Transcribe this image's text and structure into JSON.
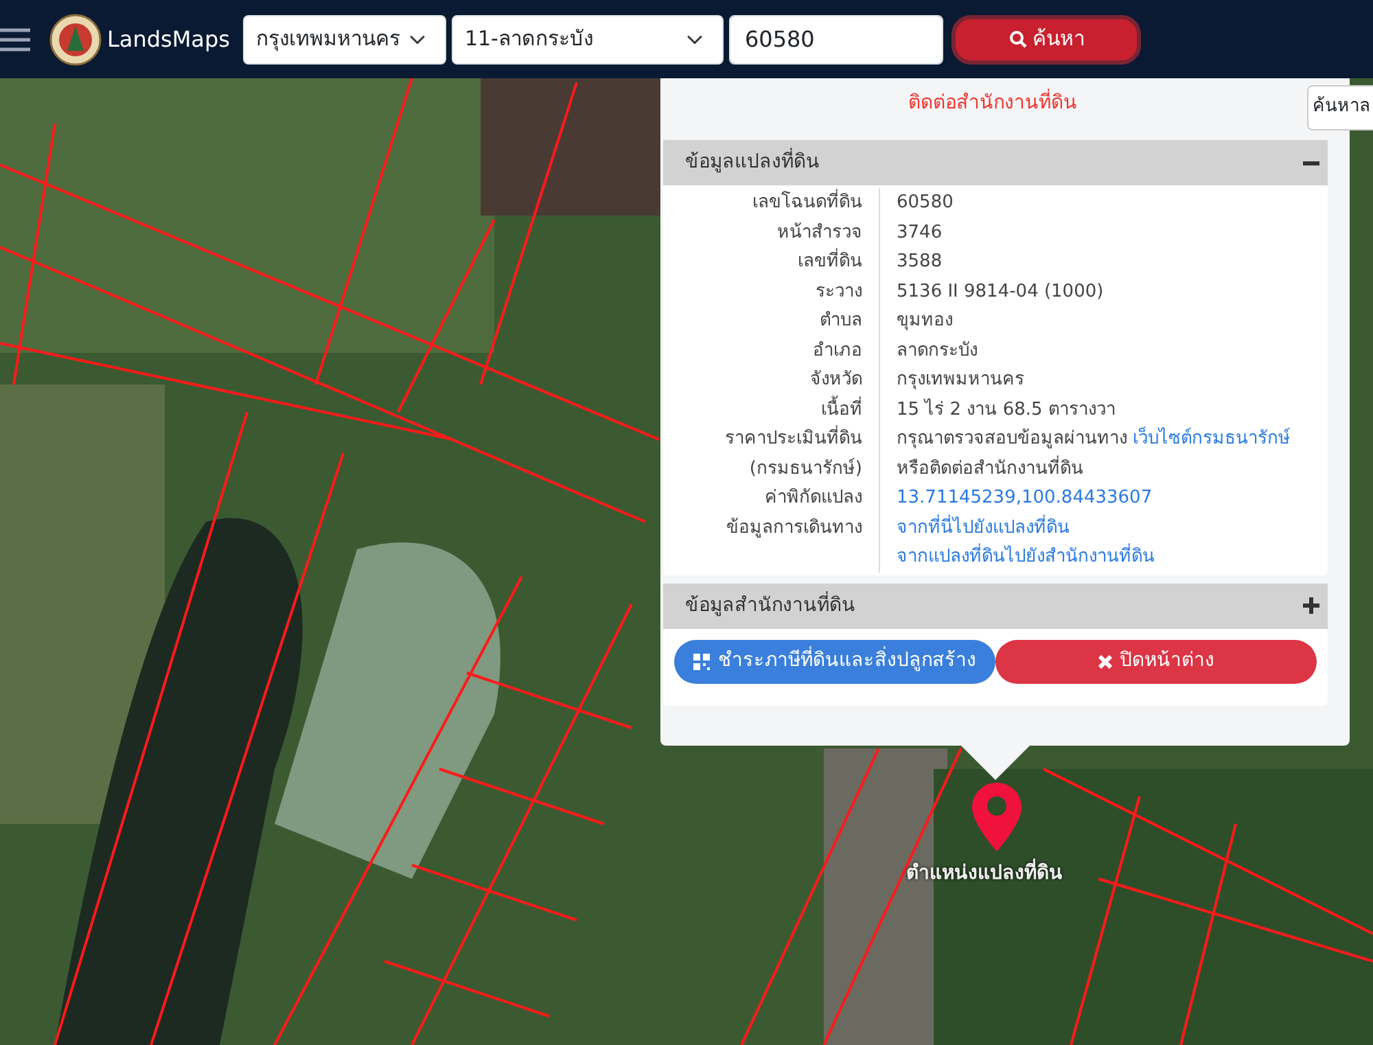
{
  "navbar": {
    "brand": "LandsMaps",
    "province": "กรุงเทพมหานคร",
    "district": "11-ลาดกระบัง",
    "parcel_no": "60580",
    "search_button": "ค้นหา"
  },
  "side_search": {
    "label": "ค้นหาล"
  },
  "popup": {
    "notice": "ติดต่อสำนักงานที่ดิน",
    "sections": [
      {
        "title": "ข้อมูลแปลงที่ดิน",
        "expanded": true,
        "rows": [
          {
            "label": "เลขโฉนดที่ดิน",
            "lines": [
              [
                {
                  "kind": "text",
                  "text": "60580"
                }
              ]
            ]
          },
          {
            "label": "หน้าสำรวจ",
            "lines": [
              [
                {
                  "kind": "text",
                  "text": "3746"
                }
              ]
            ]
          },
          {
            "label": "เลขที่ดิน",
            "lines": [
              [
                {
                  "kind": "text",
                  "text": "3588"
                }
              ]
            ]
          },
          {
            "label": "ระวาง",
            "lines": [
              [
                {
                  "kind": "text",
                  "text": "5136 II 9814-04 (1000)"
                }
              ]
            ]
          },
          {
            "label": "ตำบล",
            "lines": [
              [
                {
                  "kind": "text",
                  "text": "ขุมทอง"
                }
              ]
            ]
          },
          {
            "label": "อำเภอ",
            "lines": [
              [
                {
                  "kind": "text",
                  "text": "ลาดกระบัง"
                }
              ]
            ]
          },
          {
            "label": "จังหวัด",
            "lines": [
              [
                {
                  "kind": "text",
                  "text": "กรุงเทพมหานคร"
                }
              ]
            ]
          },
          {
            "label": "เนื้อที่",
            "lines": [
              [
                {
                  "kind": "text",
                  "text": "15 ไร่ 2 งาน 68.5 ตารางวา"
                }
              ]
            ]
          },
          {
            "label": "ราคาประเมินที่ดิน (กรมธนารักษ์)",
            "lines": [
              [
                {
                  "kind": "text",
                  "text": "กรุณาตรวจสอบข้อมูลผ่านทาง"
                },
                {
                  "kind": "link",
                  "text": "เว็บไซต์กรมธนารักษ์"
                }
              ],
              [
                {
                  "kind": "text",
                  "text": "หรือติดต่อสำนักงานที่ดิน"
                }
              ]
            ]
          },
          {
            "label": "ค่าพิกัดแปลง",
            "lines": [
              [
                {
                  "kind": "link",
                  "text": "13.71145239,100.84433607"
                }
              ]
            ]
          },
          {
            "label": "ข้อมูลการเดินทาง",
            "lines": [
              [
                {
                  "kind": "link",
                  "text": "จากที่นี่ไปยังแปลงที่ดิน"
                }
              ],
              [
                {
                  "kind": "link",
                  "text": "จากแปลงที่ดินไปยังสำนักงานที่ดิน"
                }
              ]
            ]
          }
        ]
      },
      {
        "title": "ข้อมูลสำนักงานที่ดิน",
        "expanded": false
      }
    ],
    "buttons": [
      {
        "kind": "tax",
        "label": "ชำระภาษีที่ดินและสิ่งปลูกสร้าง"
      },
      {
        "kind": "close",
        "label": "ปิดหน้าต่าง"
      }
    ]
  },
  "marker": {
    "label": "ตำแหน่งแปลงที่ดิน"
  }
}
